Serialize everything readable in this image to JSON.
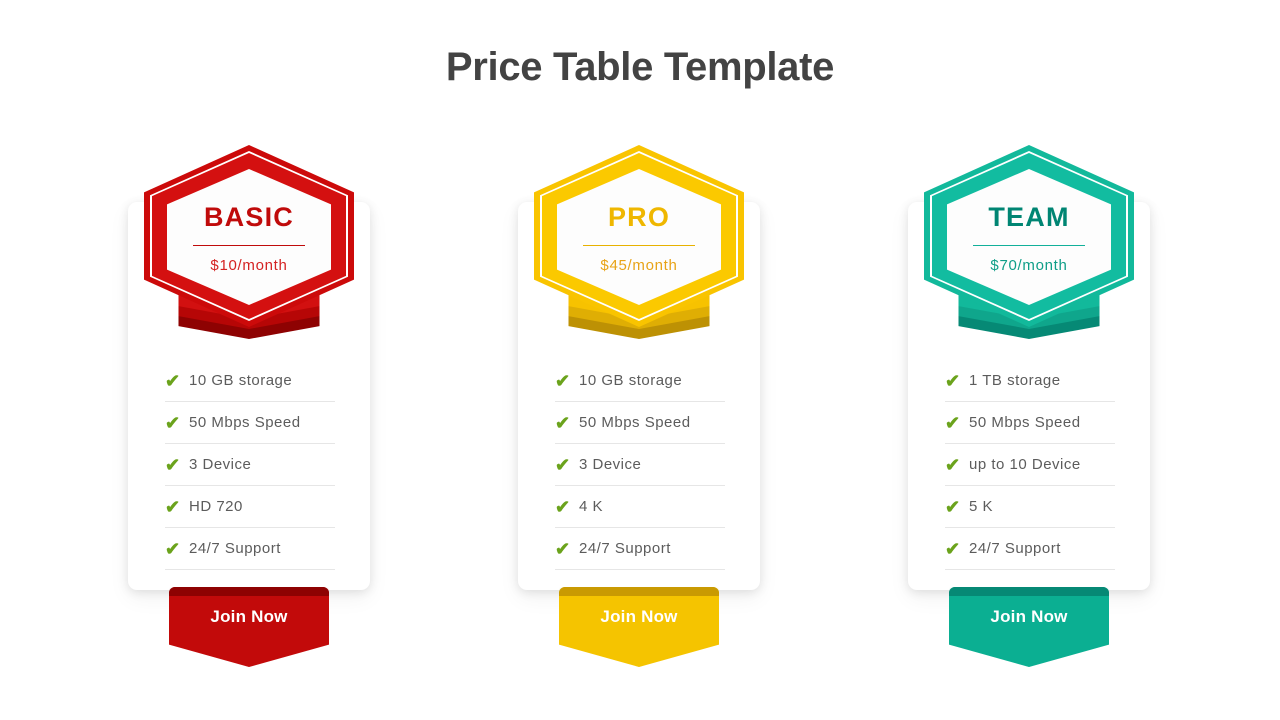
{
  "header": {
    "title": "Price Table Template",
    "title_color": "#434343"
  },
  "theme": {
    "background": "#ffffff",
    "card_background": "#ffffff",
    "feature_text_color": "#5c5c5c",
    "feature_divider_color": "#e6e6e6",
    "check_icon_color": "#6ba31c",
    "check_icon": "check-mark",
    "button_label_color": "#ffffff"
  },
  "plans": [
    {
      "name": "BASIC",
      "price": "$10/month",
      "cta_label": "Join Now",
      "colors": {
        "primary": "#CC0A0A",
        "name_text": "#C00B0B",
        "price_text": "#D42222",
        "rule": "#C00B0B",
        "hex_ring": "#D41010",
        "base_light": "#D21010",
        "base_mid": "#B60606",
        "base_dark": "#8E0202",
        "button": "#C20A0A",
        "button_top": "#8E0202"
      },
      "features": [
        "10 GB storage",
        "50 Mbps Speed",
        "3 Device",
        "HD 720",
        "24/7 Support"
      ]
    },
    {
      "name": "PRO",
      "price": "$45/month",
      "cta_label": "Join Now",
      "colors": {
        "primary": "#F9C400",
        "name_text": "#EFB700",
        "price_text": "#E8A317",
        "rule": "#E8B200",
        "hex_ring": "#FBC900",
        "base_light": "#F7C200",
        "base_mid": "#DFAE04",
        "base_dark": "#BD9104",
        "button": "#F5C400",
        "button_top": "#C99A02"
      },
      "features": [
        "10 GB storage",
        "50 Mbps Speed",
        "3 Device",
        "4 K",
        "24/7 Support"
      ]
    },
    {
      "name": "TEAM",
      "price": "$70/month",
      "cta_label": "Join Now",
      "colors": {
        "primary": "#12B99B",
        "name_text": "#008573",
        "price_text": "#0F9E88",
        "rule": "#12B09A",
        "hex_ring": "#12BCA0",
        "base_light": "#12B99B",
        "base_mid": "#0FA68C",
        "base_dark": "#068975",
        "button": "#0BAF92",
        "button_top": "#068975"
      },
      "features": [
        "1 TB storage",
        "50 Mbps Speed",
        "up to 10 Device",
        "5 K",
        "24/7 Support"
      ]
    }
  ]
}
